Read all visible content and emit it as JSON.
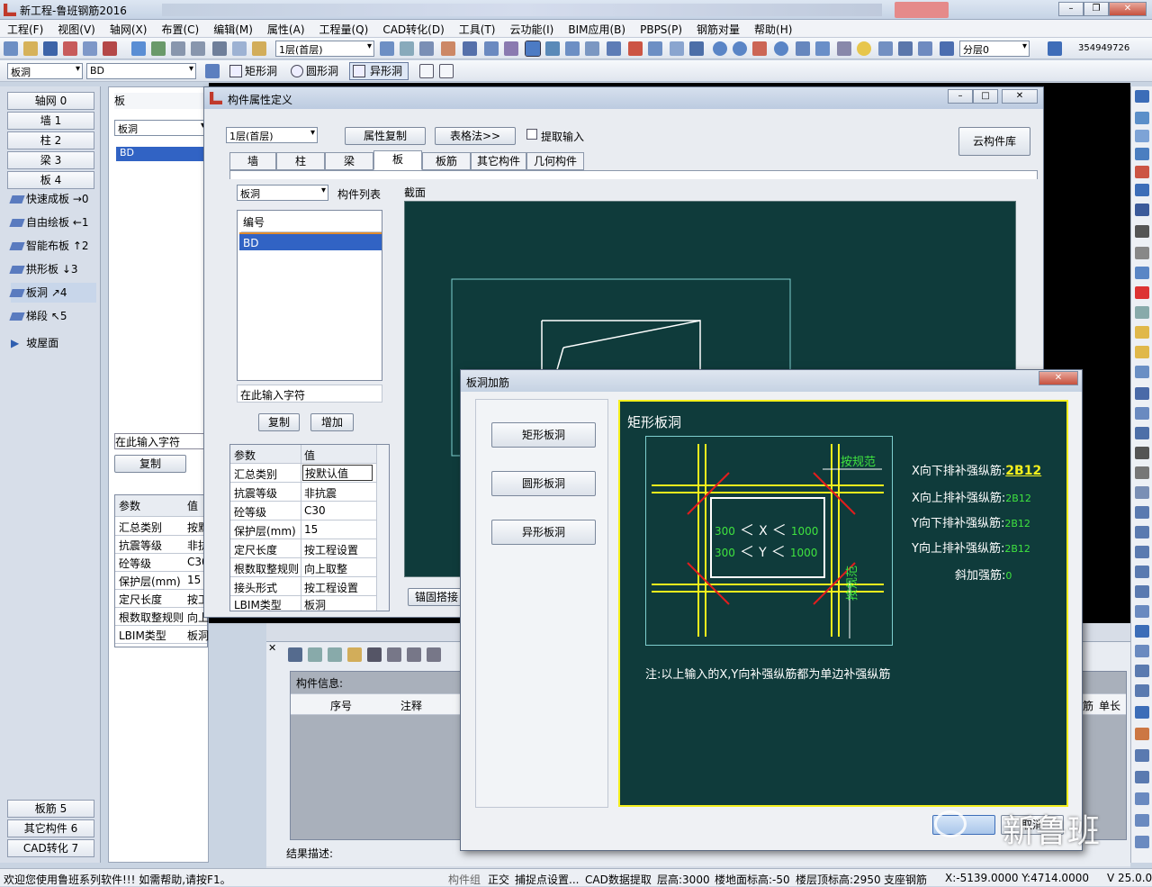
{
  "window": {
    "title": "新工程-鲁班钢筋2016"
  },
  "menu": [
    "工程(F)",
    "视图(V)",
    "轴网(X)",
    "布置(C)",
    "编辑(M)",
    "属性(A)",
    "工程量(Q)",
    "CAD转化(D)",
    "工具(T)",
    "云功能(I)",
    "BIM应用(B)",
    "PBPS(P)",
    "钢筋对量",
    "帮助(H)"
  ],
  "toolbar1": {
    "floor": "1层(首层)",
    "layer": "分层0",
    "code": "354949726"
  },
  "toolbar2": {
    "type": "板洞",
    "name": "BD",
    "rect_label": "矩形洞",
    "circle_label": "圆形洞",
    "special_label": "异形洞"
  },
  "left_panel": {
    "top_buttons": [
      "轴网 0",
      "墙 1",
      "柱 2",
      "梁 3",
      "板 4"
    ],
    "items": [
      "快速成板 →0",
      "自由绘板 ←1",
      "智能布板 ↑2",
      "拱形板 ↓3",
      "板洞 ↗4",
      "梯段 ↖5",
      "坡屋面"
    ],
    "bottom_buttons": [
      "板筋 5",
      "其它构件 6",
      "CAD转化 7"
    ]
  },
  "panel2": {
    "search": "板",
    "combo": "板洞",
    "selected": "BD",
    "input_placeholder": "在此输入字符",
    "copy": "复制"
  },
  "back_grid": {
    "col1": "参数",
    "col2": "值",
    "rows": [
      [
        "汇总类别",
        "按默"
      ],
      [
        "抗震等级",
        "非抗"
      ],
      [
        "砼等级",
        "C30"
      ],
      [
        "保护层(mm)",
        "15"
      ],
      [
        "定尺长度",
        "按工"
      ],
      [
        "根数取整规则",
        "向上取"
      ],
      [
        "LBIM类型",
        "板洞"
      ]
    ]
  },
  "dialog": {
    "title": "构件属性定义",
    "floor": "1层(首层)",
    "copy_attr": "属性复制",
    "table_method": "表格法>>",
    "extract_input": "提取输入",
    "cloud_lib": "云构件库",
    "tabs": [
      "墙",
      "柱",
      "梁",
      "板",
      "板筋",
      "其它构件",
      "几何构件"
    ],
    "type_combo": "板洞",
    "list_label": "构件列表",
    "section_label": "截面",
    "list_header": "编号",
    "list_item": "BD",
    "input_placeholder": "在此输入字符",
    "copy": "复制",
    "add": "增加",
    "anchor_btn": "锚固搭接",
    "params_header": [
      "参数",
      "值"
    ],
    "params": [
      [
        "汇总类别",
        "按默认值"
      ],
      [
        "抗震等级",
        "非抗震"
      ],
      [
        "砼等级",
        "C30"
      ],
      [
        "保护层(mm)",
        "15"
      ],
      [
        "定尺长度",
        "按工程设置"
      ],
      [
        "根数取整规则",
        "向上取整"
      ],
      [
        "接头形式",
        "按工程设置"
      ],
      [
        "LBIM类型",
        "板洞"
      ]
    ]
  },
  "bottom_area": {
    "info_label": "构件信息:",
    "col_seq": "序号",
    "col_note": "注释",
    "col_dan": "单长",
    "col_jin": "筋",
    "result_label": "结果描述:"
  },
  "dialog2": {
    "title": "板洞加筋",
    "btn_rect": "矩形板洞",
    "btn_circle": "圆形板洞",
    "btn_special": "异形板洞",
    "panel_title": "矩形板洞",
    "rule_label": "按规范",
    "range_x": [
      "300",
      "X",
      "1000"
    ],
    "range_y": [
      "300",
      "Y",
      "1000"
    ],
    "x_down_label": "X向下排补强纵筋:",
    "x_down_val": "2B12",
    "x_up_label": "X向上排补强纵筋:",
    "x_up_val": "2B12",
    "y_down_label": "Y向下排补强纵筋:",
    "y_down_val": "2B12",
    "y_up_label": "Y向上排补强纵筋:",
    "y_up_val": "2B12",
    "diag_label": "斜加强筋:",
    "diag_val": "0",
    "note": "注:以上输入的X,Y向补强纵筋都为单边补强纵筋",
    "cancel": "取消"
  },
  "watermark": "新鲁班",
  "status": {
    "welcome": "欢迎您使用鲁班系列软件!!!  如需帮助,请按F1。",
    "group": "构件组",
    "ortho": "正交",
    "snap": "捕捉点设置...",
    "cad": "CAD数据提取",
    "floor_h": "层高:3000",
    "ground": "楼地面标高:-50",
    "top": "楼层顶标高:2950",
    "support": "支座钢筋",
    "coords": "X:-5139.0000 Y:4714.0000",
    "version": "V 25.0.0"
  }
}
